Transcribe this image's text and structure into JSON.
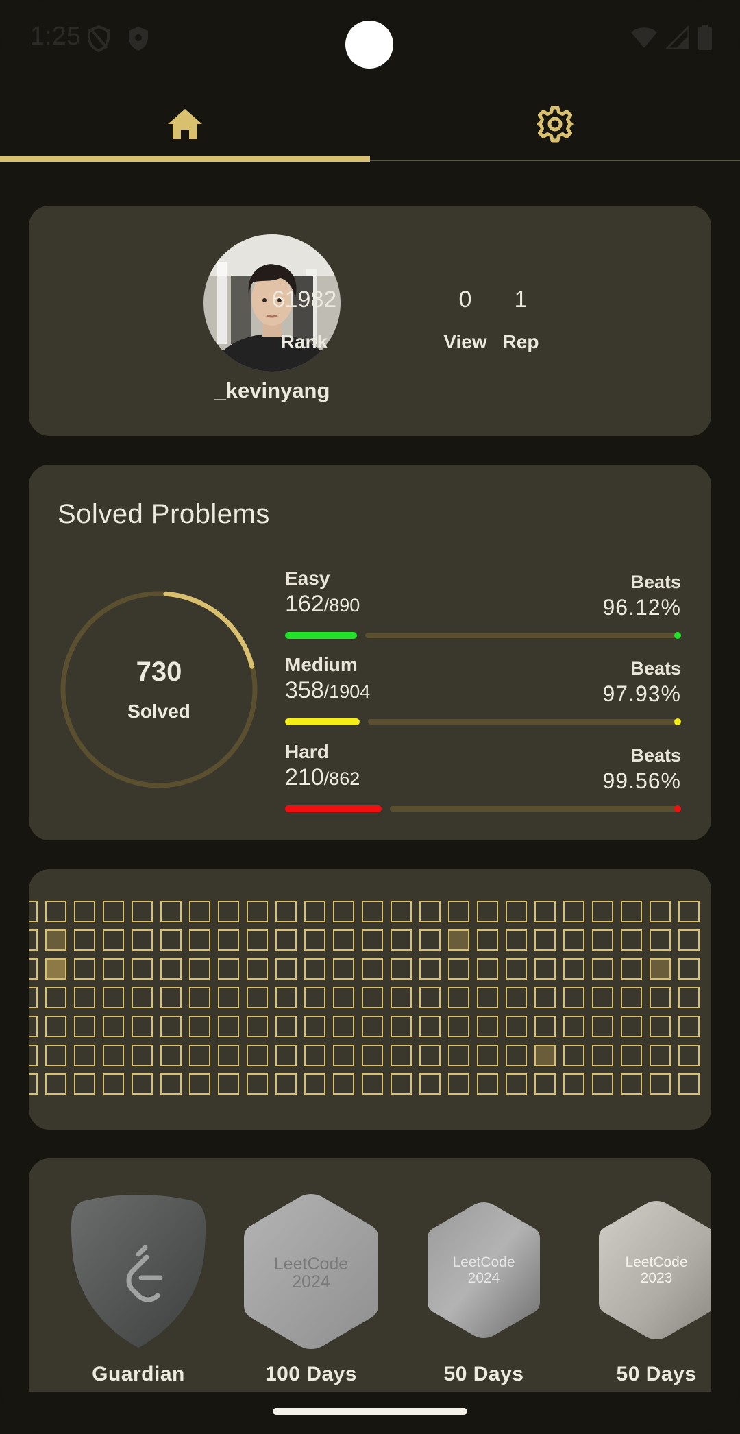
{
  "status_bar": {
    "time": "1:25",
    "icons": [
      "shield-icon",
      "shield-filled-icon",
      "wifi-icon",
      "signal-icon",
      "battery-icon"
    ]
  },
  "tabs": [
    {
      "name": "home",
      "icon": "home-icon",
      "selected": true
    },
    {
      "name": "settings",
      "icon": "gear-icon",
      "selected": false
    }
  ],
  "profile": {
    "username": "_kevinyang",
    "stats": [
      {
        "value": "61982",
        "label": "Rank"
      },
      {
        "value": "0",
        "label": "View"
      },
      {
        "value": "1",
        "label": "Rep"
      }
    ]
  },
  "solved": {
    "title": "Solved Problems",
    "total": "730",
    "total_label": "Solved",
    "progress_fraction": 0.2,
    "difficulties": [
      {
        "name": "Easy",
        "solved": "162",
        "total": "/890",
        "beats_label": "Beats",
        "beats": "96.12%",
        "color": "#22e22a",
        "fraction": 0.182
      },
      {
        "name": "Medium",
        "solved": "358",
        "total": "/1904",
        "beats_label": "Beats",
        "beats": "97.93%",
        "color": "#f5ee16",
        "fraction": 0.188
      },
      {
        "name": "Hard",
        "solved": "210",
        "total": "/862",
        "beats_label": "Beats",
        "beats": "99.56%",
        "color": "#f01010",
        "fraction": 0.244
      }
    ]
  },
  "heatmap": {
    "rows": 7,
    "cols": 24,
    "active_cells": [
      {
        "row": 1,
        "col": 1,
        "level": 1
      },
      {
        "row": 1,
        "col": 15,
        "level": 1
      },
      {
        "row": 2,
        "col": 1,
        "level": 2
      },
      {
        "row": 2,
        "col": 22,
        "level": 1
      },
      {
        "row": 5,
        "col": 18,
        "level": 1
      }
    ]
  },
  "badges": [
    {
      "label": "Guardian",
      "icon": "guardian-badge-icon"
    },
    {
      "label": "100 Days",
      "icon": "leetcode-2024-badge-icon",
      "art_text": [
        "LeetCode",
        "2024"
      ]
    },
    {
      "label": "50 Days",
      "icon": "leetcode-2024-badge-icon",
      "art_text": [
        "LeetCode",
        "2024"
      ]
    },
    {
      "label": "50 Days",
      "icon": "leetcode-2023-badge-icon",
      "art_text": [
        "LeetCode",
        "2023"
      ]
    }
  ],
  "colors": {
    "accent": "#d8c06e",
    "background": "#17150f",
    "card": "#3a372c"
  }
}
